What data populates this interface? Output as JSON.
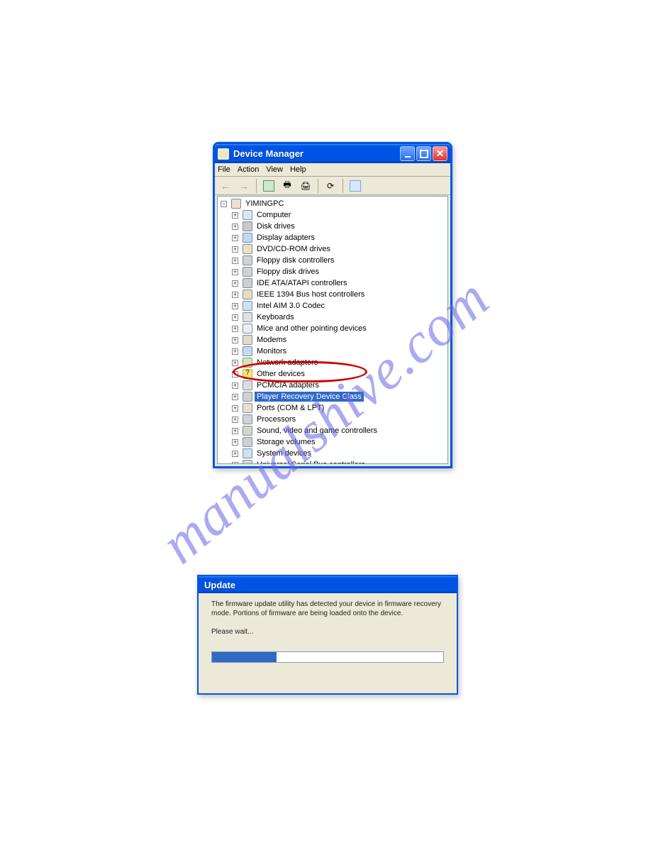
{
  "watermark_text": "manualshive.com",
  "devmgr": {
    "title": "Device Manager",
    "menus": [
      "File",
      "Action",
      "View",
      "Help"
    ],
    "root": "YIMINGPC",
    "nodes": [
      {
        "icon": "ico-computer",
        "label": "Computer"
      },
      {
        "icon": "ico-disk",
        "label": "Disk drives"
      },
      {
        "icon": "ico-display",
        "label": "Display adapters"
      },
      {
        "icon": "ico-cd",
        "label": "DVD/CD-ROM drives"
      },
      {
        "icon": "ico-floppy",
        "label": "Floppy disk controllers"
      },
      {
        "icon": "ico-floppy",
        "label": "Floppy disk drives"
      },
      {
        "icon": "ico-ide",
        "label": "IDE ATA/ATAPI controllers"
      },
      {
        "icon": "ico-1394",
        "label": "IEEE 1394 Bus host controllers"
      },
      {
        "icon": "ico-codec",
        "label": "Intel AIM 3.0 Codec"
      },
      {
        "icon": "ico-kb",
        "label": "Keyboards"
      },
      {
        "icon": "ico-mouse",
        "label": "Mice and other pointing devices"
      },
      {
        "icon": "ico-modem",
        "label": "Modems"
      },
      {
        "icon": "ico-monitor",
        "label": "Monitors"
      },
      {
        "icon": "ico-net",
        "label": "Network adapters"
      },
      {
        "icon": "ico-other",
        "label": "Other devices"
      },
      {
        "icon": "ico-pcmcia",
        "label": "PCMCIA adapters"
      },
      {
        "icon": "ico-player",
        "label": "Player Recovery Device Class",
        "selected": true,
        "circled": true
      },
      {
        "icon": "ico-ports",
        "label": "Ports (COM & LPT)"
      },
      {
        "icon": "ico-proc",
        "label": "Processors"
      },
      {
        "icon": "ico-sound",
        "label": "Sound, video and game controllers"
      },
      {
        "icon": "ico-storage",
        "label": "Storage volumes"
      },
      {
        "icon": "ico-system",
        "label": "System devices"
      },
      {
        "icon": "ico-usb",
        "label": "Universal Serial Bus controllers"
      }
    ]
  },
  "update": {
    "title": "Update",
    "message": "The firmware update utility has detected your device in firmware recovery mode. Portions of firmware are being loaded onto the device.",
    "wait": "Please wait...",
    "progress_percent": 28
  }
}
